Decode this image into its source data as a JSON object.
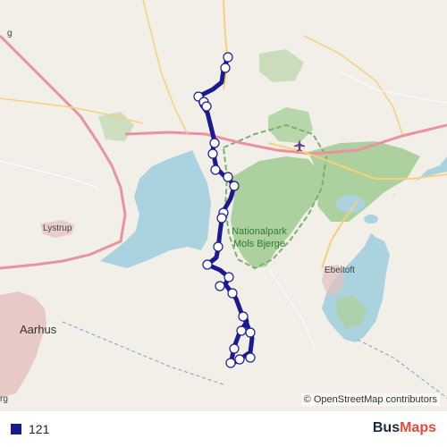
{
  "map": {
    "attribution": "© OpenStreetMap contributors",
    "places": [
      {
        "id": "aarhus",
        "name": "Aarhus"
      },
      {
        "id": "lystrup",
        "name": "Lystrup"
      },
      {
        "id": "ebeltoft",
        "name": "Ebeltoft"
      },
      {
        "id": "national-park",
        "name": "Nationalpark Mols Bjerge"
      },
      {
        "id": "edge-g",
        "name": "g"
      },
      {
        "id": "edge-rg",
        "name": "rg"
      }
    ],
    "icons": [
      "airport-icon"
    ],
    "colors": {
      "route": "#1b1b8f",
      "sea": "#aad3df",
      "land": "#f2efe9",
      "forest": "#add19e",
      "park_border": "#79b26f",
      "urban": "#e3c0bd",
      "motorway": "#e892a2",
      "primary_road": "#f6d17b"
    }
  },
  "legend": {
    "route_label": "121",
    "route_color": "#1b1b8f"
  },
  "brand": {
    "part1": "Bus",
    "part2": "Maps"
  }
}
